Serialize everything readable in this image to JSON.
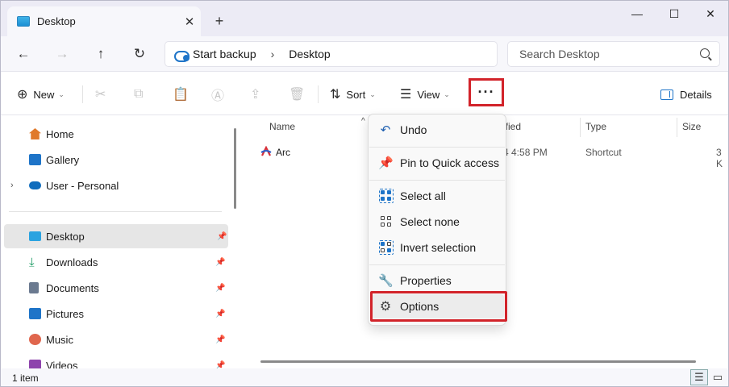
{
  "window": {
    "tab_title": "Desktop",
    "tab_close": "✕",
    "new_tab": "+",
    "controls": {
      "minimize": "—",
      "maximize": "☐",
      "close": "✕"
    }
  },
  "nav": {
    "back": "←",
    "forward": "→",
    "up": "↑",
    "refresh": "↻"
  },
  "address": {
    "breadcrumbs": [
      "Start backup",
      "Desktop"
    ],
    "separator": "›"
  },
  "search": {
    "placeholder": "Search Desktop"
  },
  "toolbar": {
    "new_label": "New",
    "sort_label": "Sort",
    "view_label": "View",
    "more_label": "···",
    "details_label": "Details",
    "icons": {
      "new": "⊕",
      "cut": "✂",
      "copy": "⧉",
      "paste": "📋",
      "rename": "Ⓐ",
      "share": "⇪",
      "delete": "🗑",
      "sort": "⇅",
      "view": "☰"
    },
    "chevron": "⌄"
  },
  "sidebar": {
    "items": [
      {
        "label": "Home",
        "icon": "home-icon",
        "color": "#e07a2b"
      },
      {
        "label": "Gallery",
        "icon": "gallery-icon",
        "color": "#1e74c8"
      },
      {
        "label": "User - Personal",
        "icon": "onedrive-icon",
        "color": "#0f6cbd",
        "expander": "›"
      },
      {
        "label": "Desktop",
        "icon": "desktop-icon",
        "color": "#2ba3e0",
        "pinned": true,
        "selected": true
      },
      {
        "label": "Downloads",
        "icon": "downloads-icon",
        "color": "#1a9a62",
        "pinned": true
      },
      {
        "label": "Documents",
        "icon": "documents-icon",
        "color": "#6b7a90",
        "pinned": true
      },
      {
        "label": "Pictures",
        "icon": "pictures-icon",
        "color": "#1e74c8",
        "pinned": true
      },
      {
        "label": "Music",
        "icon": "music-icon",
        "color": "#e0664d",
        "pinned": true
      },
      {
        "label": "Videos",
        "icon": "videos-icon",
        "color": "#8e44ad",
        "pinned": true
      }
    ],
    "pin_glyph": "📌"
  },
  "columns": {
    "name": "Name",
    "modified": "ified",
    "type": "Type",
    "size": "Size",
    "sort_caret": "^"
  },
  "files": [
    {
      "name": "Arc",
      "modified": "4 4:58 PM",
      "type": "Shortcut",
      "size": "3 K"
    }
  ],
  "status": {
    "count": "1 item",
    "details_view": "☰",
    "tiles_view": "▭"
  },
  "menu": {
    "items": [
      {
        "label": "Undo",
        "icon": "undo-icon",
        "glyph": "↶"
      },
      {
        "label": "Pin to Quick access",
        "icon": "pin-icon",
        "glyph": "📌"
      },
      {
        "label": "Select all",
        "icon": "select-all-icon"
      },
      {
        "label": "Select none",
        "icon": "select-none-icon"
      },
      {
        "label": "Invert selection",
        "icon": "invert-selection-icon"
      },
      {
        "label": "Properties",
        "icon": "properties-icon",
        "glyph": "🔧"
      },
      {
        "label": "Options",
        "icon": "options-gear-icon",
        "glyph": "⚙"
      }
    ]
  },
  "colors": {
    "highlight": "#d2232a",
    "accent": "#1e74c8",
    "selected_bg": "#e6e6e6"
  }
}
